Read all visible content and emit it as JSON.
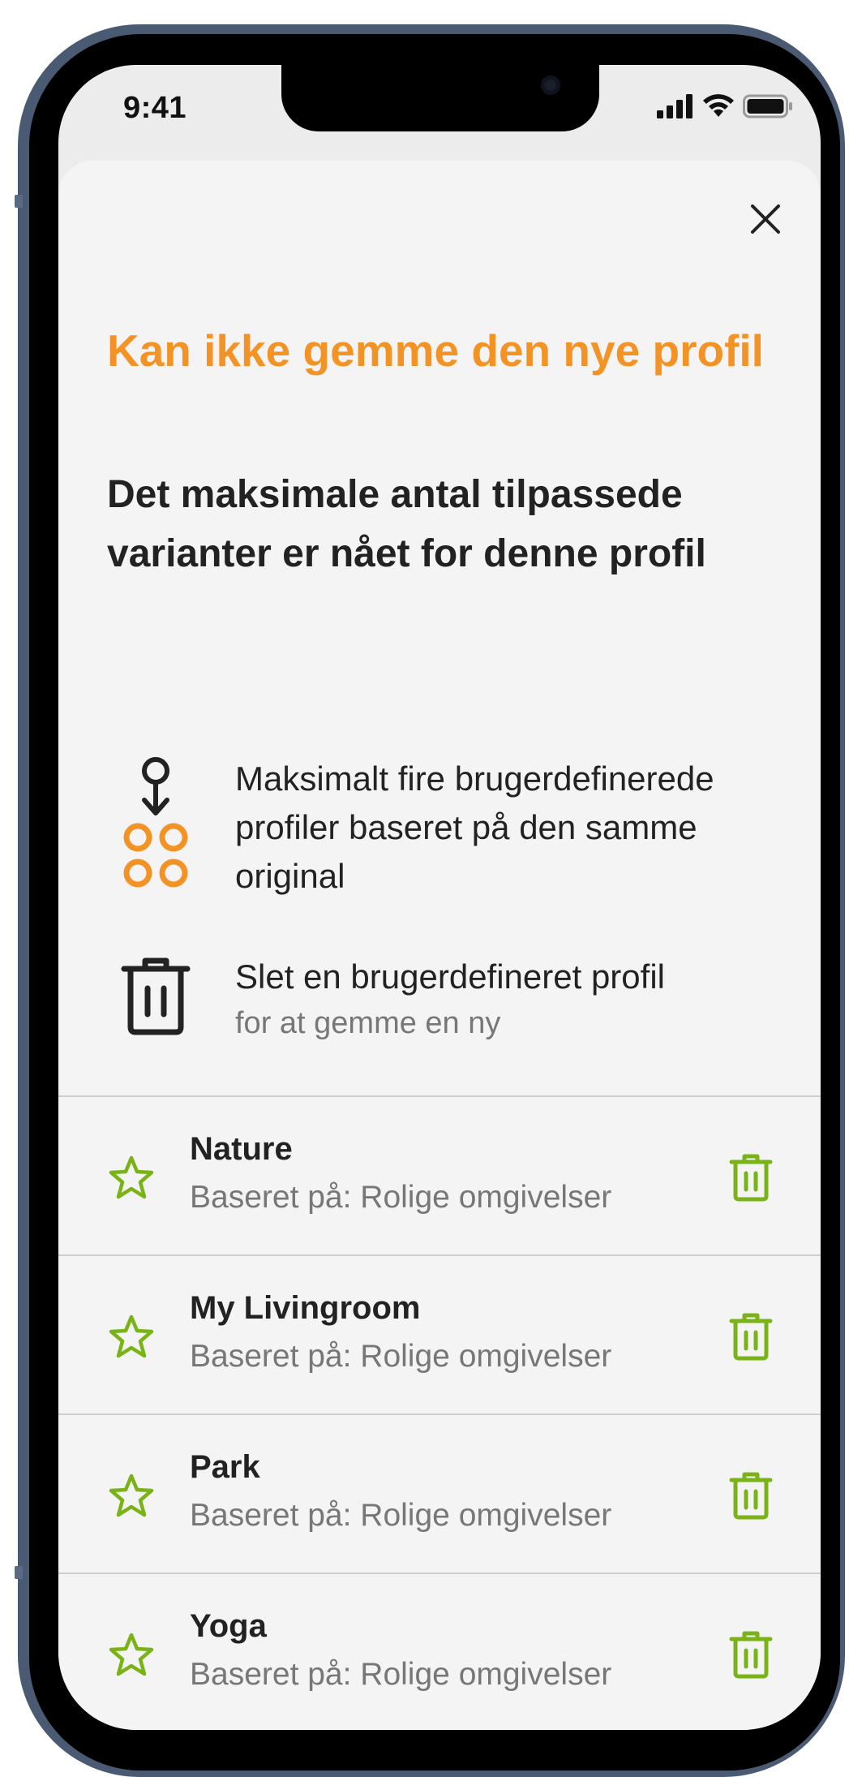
{
  "status_bar": {
    "time": "9:41"
  },
  "dialog": {
    "title": "Kan ikke gemme den nye profil",
    "subtitle": "Det maksimale antal tilpassede varianter er nået for denne profil",
    "info_limit": "Maksimalt fire brugerdefinerede profiler baseret på den samme original",
    "info_delete_main": "Slet en brugerdefineret profil",
    "info_delete_sub": "for at gemme en ny"
  },
  "profiles": [
    {
      "name": "Nature",
      "based_on": "Baseret på: Rolige omgivelser"
    },
    {
      "name": "My Livingroom",
      "based_on": "Baseret på: Rolige omgivelser"
    },
    {
      "name": "Park",
      "based_on": "Baseret på: Rolige omgivelser"
    },
    {
      "name": "Yoga",
      "based_on": "Baseret på: Rolige omgivelser"
    }
  ],
  "colors": {
    "accent_orange": "#f39325",
    "accent_green": "#7ab317",
    "text_dark": "#222222",
    "text_muted": "#777777",
    "sheet_bg": "#f4f4f4",
    "frame": "#4a5a73"
  },
  "icons": {
    "close": "close-icon",
    "limit": "profile-variants-icon",
    "delete_info": "trash-icon",
    "favorite": "star-icon",
    "delete_item": "trash-icon",
    "signal": "cellular-signal-icon",
    "wifi": "wifi-icon",
    "battery": "battery-icon"
  }
}
